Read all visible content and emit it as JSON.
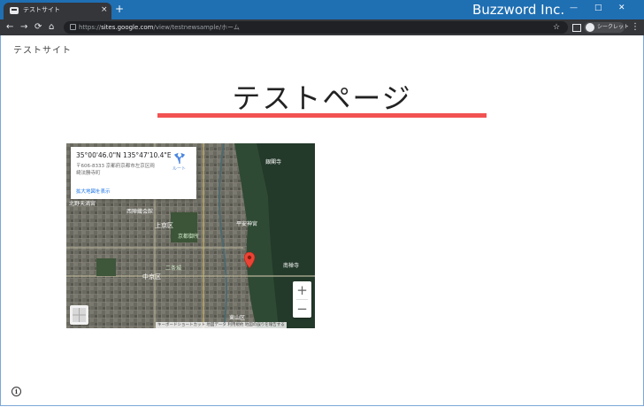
{
  "browser": {
    "tab": {
      "title": "テストサイト",
      "close": "×"
    },
    "new_tab": "+",
    "brand": "Buzzword Inc.",
    "window_controls": {
      "minimize": "—",
      "maximize": "□",
      "close": "✕"
    },
    "nav": {
      "back": "←",
      "forward": "→",
      "reload": "⟳",
      "home": "⌂"
    },
    "url": {
      "scheme": "https://",
      "host": "sites.google.com",
      "path": "/view/testnewsample/ホーム"
    },
    "star": "☆",
    "incognito_label": "シークレット",
    "menu": "⋮"
  },
  "page": {
    "site_name": "テストサイト",
    "heading": "テストページ",
    "accent_color": "#f25252"
  },
  "map": {
    "info_card": {
      "coordinates": "35°00'46.0\"N 135°47'10.4\"E",
      "address": "〒606-8333 京都府京都市左京区岡崎法勝寺町",
      "directions_label": "ルート",
      "larger_map_link": "拡大地図を表示"
    },
    "zoom_in": "+",
    "zoom_out": "−",
    "attribution": "キーボードショートカット  地図データ  利用規約  地図の誤りを報告する",
    "labels": [
      "北野天満宮",
      "西陣織会館",
      "上京区",
      "京都御所",
      "中京区",
      "二条城",
      "南禅寺",
      "銀閣寺",
      "東山区",
      "平安神宮"
    ],
    "marker_color": "#ea4335"
  },
  "footer": {
    "info_icon": "i"
  }
}
